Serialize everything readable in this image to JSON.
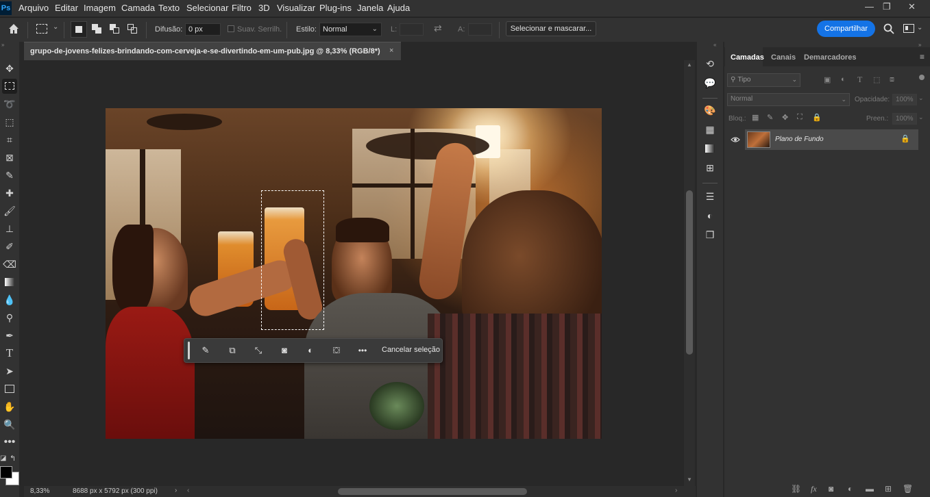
{
  "app": {
    "logo": "Ps"
  },
  "menu": [
    "Arquivo",
    "Editar",
    "Imagem",
    "Camada",
    "Texto",
    "Selecionar",
    "Filtro",
    "3D",
    "Visualizar",
    "Plug-ins",
    "Janela",
    "Ajuda"
  ],
  "window_controls": {
    "minimize": "—",
    "restore": "❐",
    "close": "✕"
  },
  "options": {
    "feather_label": "Difusão:",
    "feather_value": "0 px",
    "antialias_label": "Suav. Serrilh.",
    "style_label": "Estilo:",
    "style_value": "Normal",
    "width_label": "L:",
    "height_label": "A:",
    "select_mask_button": "Selecionar e mascarar...",
    "share_button": "Compartilhar"
  },
  "document": {
    "tab_title": "grupo-de-jovens-felizes-brindando-com-cerveja-e-se-divertindo-em-um-pub.jpg @ 8,33% (RGB/8*)",
    "close_glyph": "×"
  },
  "context_bar": {
    "cancel_label": "Cancelar seleção"
  },
  "status": {
    "zoom": "8,33%",
    "doc_info": "8688 px x 5792 px (300 ppi)"
  },
  "panel": {
    "tabs": [
      "Camadas",
      "Canais",
      "Demarcadores"
    ],
    "filter_placeholder": "Tipo",
    "blend_mode": "Normal",
    "opacity_label": "Opacidade:",
    "opacity_value": "100%",
    "lock_label": "Bloq.:",
    "fill_label": "Preen.:",
    "fill_value": "100%",
    "layers": [
      {
        "name": "Plano de Fundo",
        "visible": true,
        "locked": true
      }
    ]
  },
  "colors": {
    "accent": "#1473e6",
    "foreground": "#000000",
    "background": "#ffffff"
  }
}
